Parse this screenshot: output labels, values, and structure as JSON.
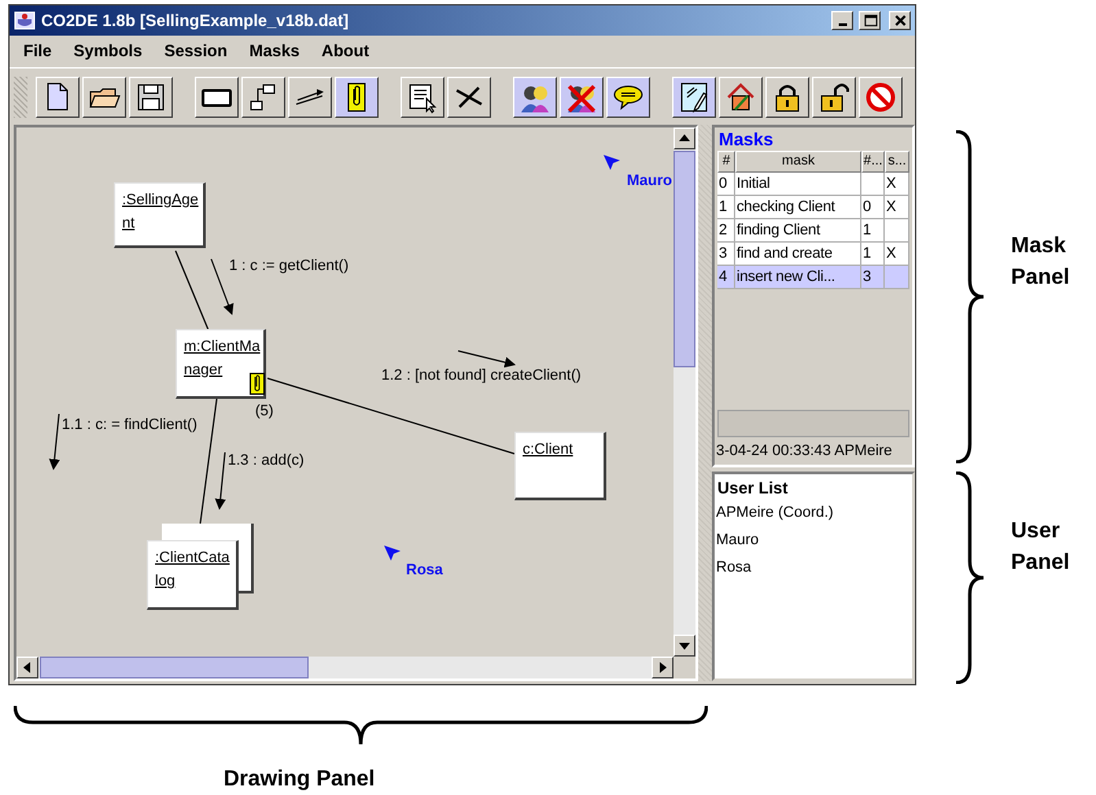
{
  "window": {
    "title": "CO2DE 1.8b [SellingExample_v18b.dat]"
  },
  "menu": [
    "File",
    "Symbols",
    "Session",
    "Masks",
    "About"
  ],
  "diagram": {
    "objects": [
      {
        "kind": "object",
        "label_lines": [
          ":SellingAge",
          "nt"
        ]
      },
      {
        "kind": "object",
        "label_lines": [
          "m:ClientMa",
          "nager"
        ],
        "attachment_count": "(5)"
      },
      {
        "kind": "object",
        "label_lines": [
          "c:Client"
        ]
      },
      {
        "kind": "multiobject",
        "label_lines": [
          ":ClientCata",
          "log"
        ]
      }
    ],
    "messages": [
      {
        "label": "1 : c := getClient()"
      },
      {
        "label": "1.2 : [not found] createClient()"
      },
      {
        "label": "1.1 : c: = findClient()"
      },
      {
        "label": "1.3 : add(c)"
      }
    ],
    "remote_cursors": [
      {
        "user": "Mauro"
      },
      {
        "user": "Rosa"
      }
    ]
  },
  "masks": {
    "title": "Masks",
    "columns": [
      "#",
      "mask",
      "#...",
      "s..."
    ],
    "rows": [
      {
        "cells": [
          "0",
          "Initial",
          "",
          "X"
        ],
        "selected": false
      },
      {
        "cells": [
          "1",
          "checking Client",
          "0",
          "X"
        ],
        "selected": false
      },
      {
        "cells": [
          "2",
          "finding Client",
          "1",
          ""
        ],
        "selected": false
      },
      {
        "cells": [
          "3",
          "find and create",
          "1",
          "X"
        ],
        "selected": false
      },
      {
        "cells": [
          "4",
          "insert new Cli...",
          "3",
          ""
        ],
        "selected": true
      }
    ],
    "status": "3-04-24 00:33:43 APMeire"
  },
  "users": {
    "title": "User List",
    "items": [
      "APMeire (Coord.)",
      "Mauro",
      "Rosa"
    ]
  },
  "annotations": {
    "mask_panel": "Mask Panel",
    "user_panel": "User Panel",
    "drawing_panel": "Drawing Panel"
  }
}
